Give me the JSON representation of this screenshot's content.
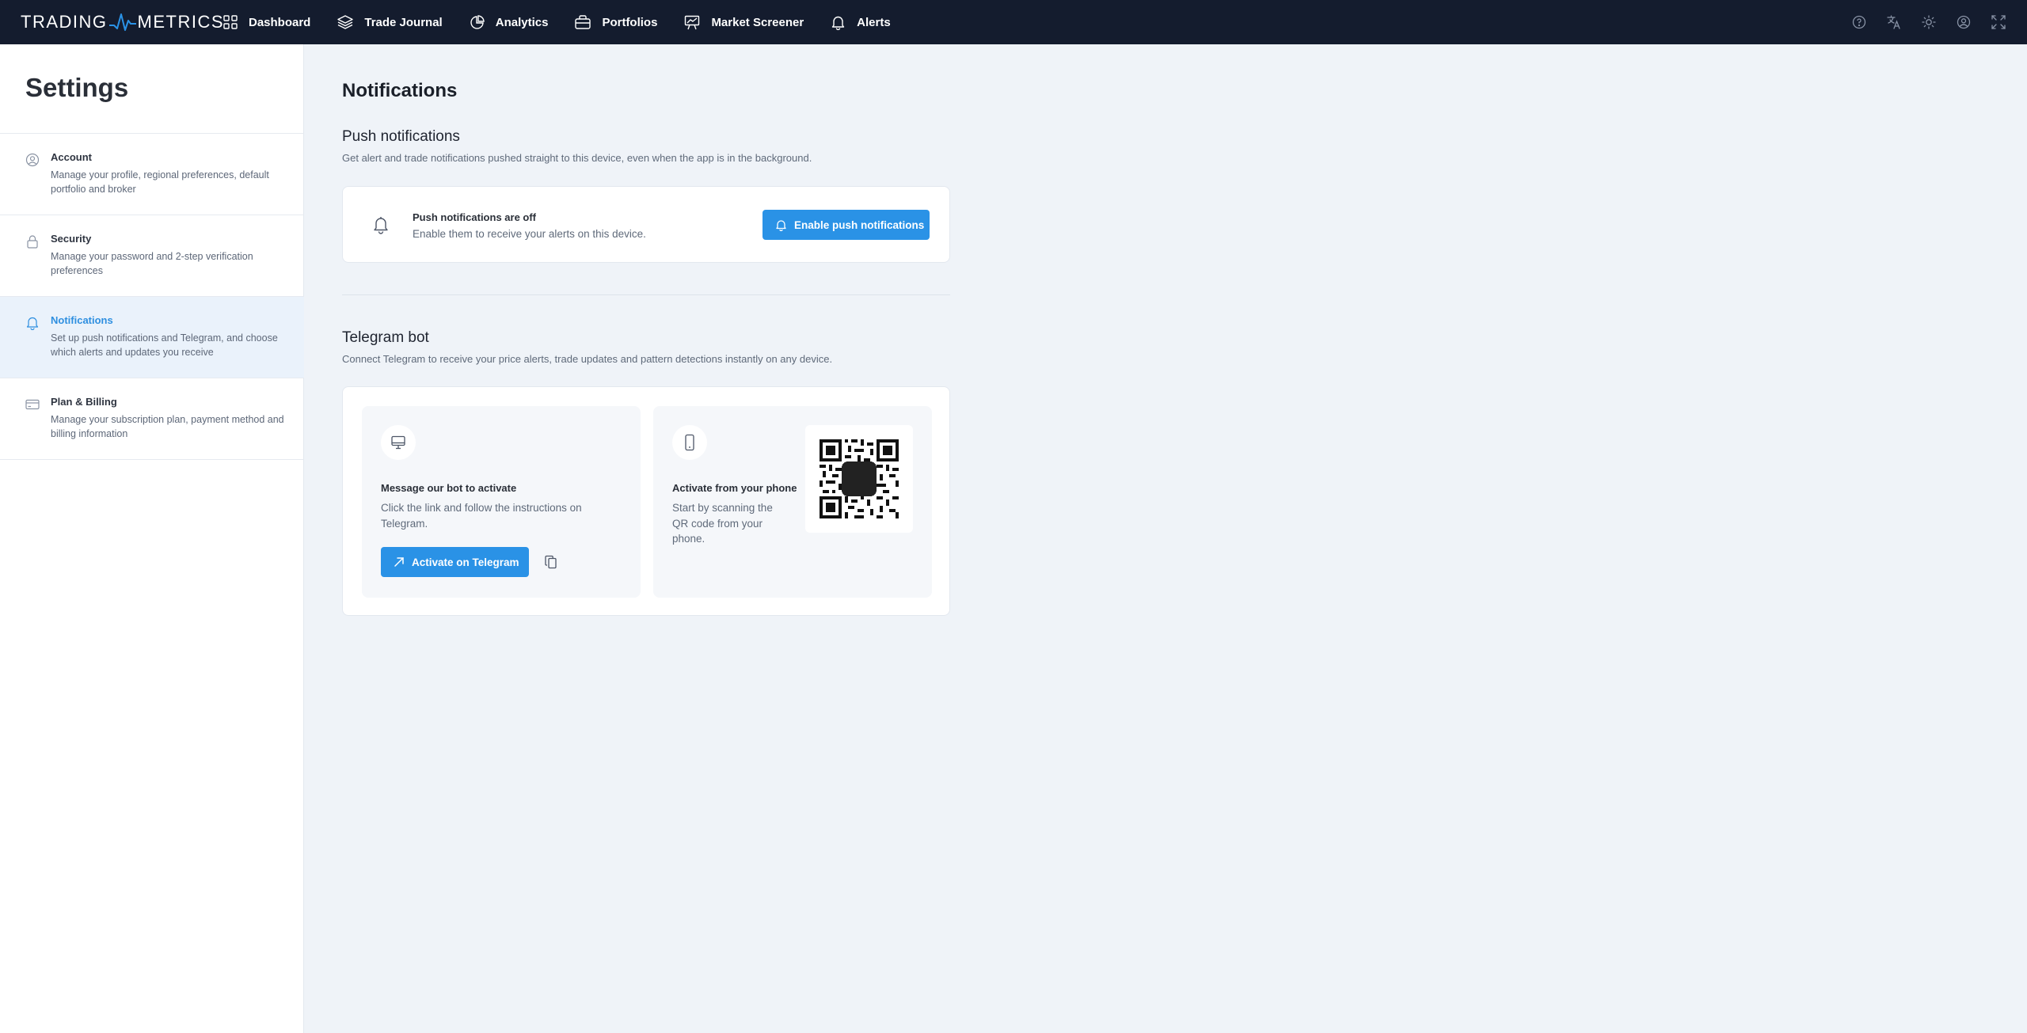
{
  "topbar": {
    "logo_left": "TRADING",
    "logo_right": "METRICS",
    "nav": [
      {
        "label": "Dashboard",
        "icon": "grid-icon"
      },
      {
        "label": "Trade Journal",
        "icon": "layers-icon"
      },
      {
        "label": "Analytics",
        "icon": "pie-chart-icon"
      },
      {
        "label": "Portfolios",
        "icon": "briefcase-icon"
      },
      {
        "label": "Market Screener",
        "icon": "presentation-chart-icon"
      },
      {
        "label": "Alerts",
        "icon": "bell-icon"
      }
    ],
    "right_icons": [
      "help-icon",
      "translate-icon",
      "theme-sun-icon",
      "user-profile-icon",
      "fullscreen-icon"
    ]
  },
  "sidebar": {
    "title": "Settings",
    "items": [
      {
        "title": "Account",
        "desc": "Manage your profile, regional preferences, default portfolio and broker",
        "icon": "user-circle-icon",
        "active": false
      },
      {
        "title": "Security",
        "desc": "Manage your password and 2-step verification preferences",
        "icon": "lock-icon",
        "active": false
      },
      {
        "title": "Notifications",
        "desc": "Set up push notifications and Telegram, and choose which alerts and updates you receive",
        "icon": "bell-icon",
        "active": true
      },
      {
        "title": "Plan & Billing",
        "desc": "Manage your subscription plan, payment method and billing information",
        "icon": "credit-card-icon",
        "active": false
      }
    ]
  },
  "main": {
    "title": "Notifications",
    "push": {
      "section_title": "Push notifications",
      "section_desc": "Get alert and trade notifications pushed straight to this device, even when the app is in the background.",
      "status_title": "Push notifications are off",
      "status_desc": "Enable them to receive your alerts on this device.",
      "button": "Enable push notifications"
    },
    "telegram": {
      "section_title": "Telegram bot",
      "section_desc": "Connect Telegram to receive your price alerts, trade updates and pattern detections instantly on any device.",
      "bot_title": "Message our bot to activate",
      "bot_desc": "Click the link and follow the instructions on Telegram.",
      "bot_button": "Activate on Telegram",
      "phone_title": "Activate from your phone",
      "phone_desc": "Start by scanning the QR code from your phone."
    }
  },
  "colors": {
    "topbar_bg": "#141c2e",
    "accent": "#2a92e6",
    "page_bg": "#eff3f8",
    "active_item_bg": "#eaf2fb"
  }
}
